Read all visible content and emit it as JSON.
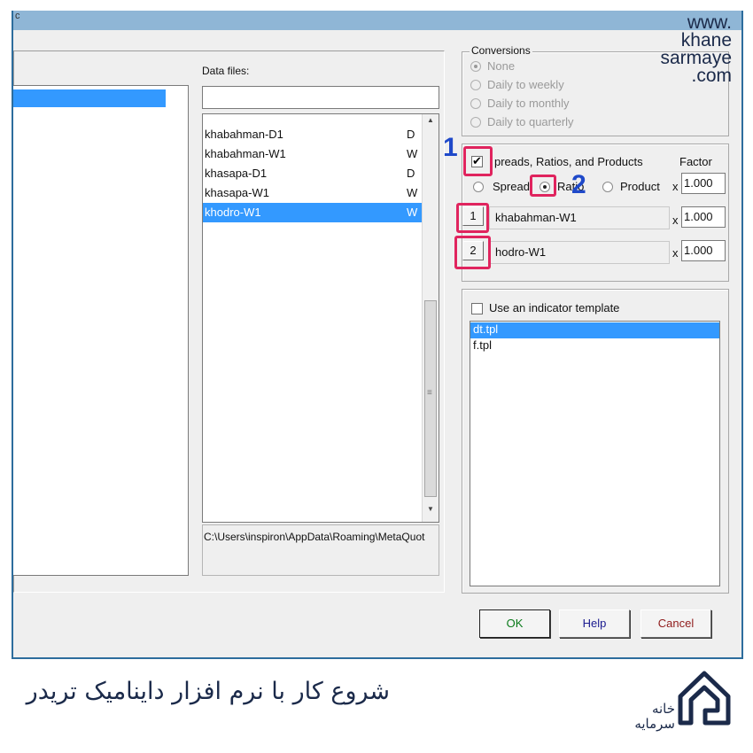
{
  "watermark": [
    "www.",
    "khane",
    "sarmaye",
    ".com"
  ],
  "data_files": {
    "label": "Data files:",
    "search_value": "",
    "items": [
      {
        "name": "khabahman-D1",
        "col": "D"
      },
      {
        "name": "khabahman-W1",
        "col": "W"
      },
      {
        "name": "khasapa-D1",
        "col": "D"
      },
      {
        "name": "khasapa-W1",
        "col": "W"
      },
      {
        "name": "khodro-W1",
        "col": "W",
        "selected": true
      }
    ],
    "path": "C:\\Users\\inspiron\\AppData\\Roaming\\MetaQuot"
  },
  "conversions": {
    "title": "Conversions",
    "options": [
      "None",
      "Daily to weekly",
      "Daily to monthly",
      "Daily to quarterly"
    ]
  },
  "spreads": {
    "checkbox_label": "preads, Ratios, and Products",
    "factor_label": "Factor",
    "radio_spread": "Spread",
    "radio_ratio": "Ratio",
    "radio_product": "Product",
    "x": "x",
    "factor1": "1.000",
    "factor2": "1.000",
    "factor3": "1.000",
    "sym1_num": "1",
    "sym1": "khabahman-W1",
    "sym2_num": "2",
    "sym2": "hodro-W1"
  },
  "template": {
    "checkbox_label": "Use an indicator template",
    "items": [
      "dt.tpl",
      "f.tpl"
    ]
  },
  "buttons": {
    "ok": "OK",
    "help": "Help",
    "cancel": "Cancel"
  },
  "callouts": {
    "one": "1",
    "two": "2"
  },
  "caption": "شروع کار با نرم افزار داینامیک تریدر",
  "logo_lines": [
    "خانه",
    "سرمایه"
  ],
  "colors": {
    "selection": "#3399ff",
    "highlight": "#e0245e",
    "callout": "#1f49c9",
    "dialog_border": "#2d6d9d"
  }
}
